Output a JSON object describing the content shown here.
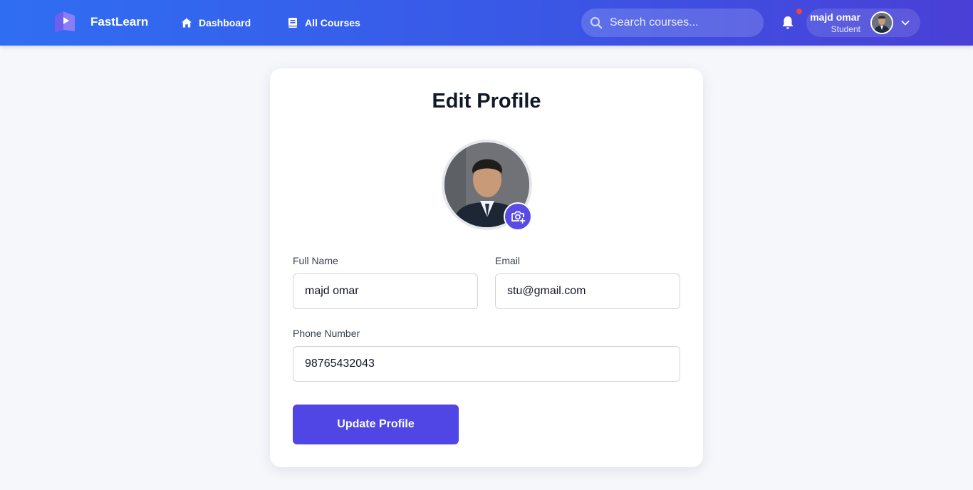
{
  "app": {
    "brand_name": "FastLearn",
    "accent_color": "#4f46e5",
    "nav_gradient": [
      "#2f6ef3",
      "#4a3fd6"
    ]
  },
  "nav": {
    "links": [
      {
        "label": "Dashboard",
        "icon": "home-icon"
      },
      {
        "label": "All Courses",
        "icon": "book-icon"
      }
    ],
    "search": {
      "placeholder": "Search courses...",
      "value": "",
      "icon": "search-icon"
    },
    "notifications": {
      "icon": "bell-icon",
      "has_unread": true,
      "dot_color": "#ef4444"
    },
    "user": {
      "name": "majd omar",
      "role": "Student",
      "avatar": "user-avatar",
      "menu_icon": "chevron-down-icon"
    }
  },
  "page": {
    "title": "Edit Profile",
    "photo": {
      "alt": "profile photo",
      "upload_icon": "camera-plus-icon"
    },
    "fields": {
      "full_name": {
        "label": "Full Name",
        "value": "majd omar"
      },
      "email": {
        "label": "Email",
        "value": "stu@gmail.com"
      },
      "phone": {
        "label": "Phone Number",
        "value": "98765432043"
      }
    },
    "submit_label": "Update Profile"
  }
}
